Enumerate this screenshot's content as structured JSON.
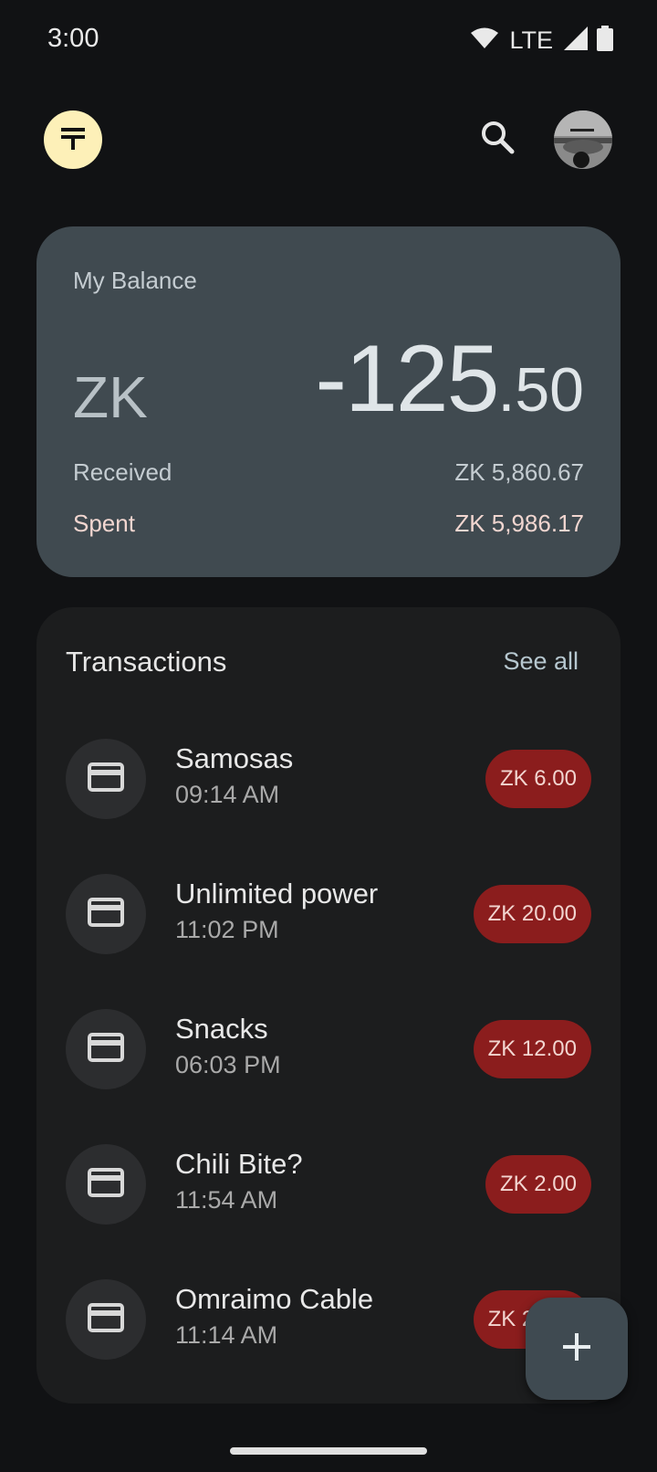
{
  "status_bar": {
    "time": "3:00",
    "network": "LTE",
    "icons": [
      "wifi-icon",
      "cell-signal-icon",
      "battery-icon"
    ]
  },
  "app_bar": {
    "logo_icon": "currency-logo-icon",
    "search_icon": "search-icon",
    "avatar": "profile-avatar"
  },
  "balance": {
    "label": "My Balance",
    "currency": "ZK",
    "amount_int": "-125",
    "amount_dec": ".50",
    "received_label": "Received",
    "received_value": "ZK 5,860.67",
    "spent_label": "Spent",
    "spent_value": "ZK 5,986.17"
  },
  "transactions": {
    "title": "Transactions",
    "see_all": "See all",
    "items": [
      {
        "name": "Samosas",
        "time": "09:14 AM",
        "amount": "ZK 6.00",
        "icon": "card-icon"
      },
      {
        "name": "Unlimited power",
        "time": "11:02 PM",
        "amount": "ZK 20.00",
        "icon": "card-icon"
      },
      {
        "name": "Snacks",
        "time": "06:03 PM",
        "amount": "ZK 12.00",
        "icon": "card-icon"
      },
      {
        "name": "Chili Bite?",
        "time": "11:54 AM",
        "amount": "ZK 2.00",
        "icon": "card-icon"
      },
      {
        "name": "Omraimo Cable",
        "time": "11:14 AM",
        "amount": "ZK 25.00",
        "icon": "card-icon"
      }
    ]
  },
  "fab": {
    "icon": "plus-icon"
  },
  "colors": {
    "background": "#111214",
    "balance_card": "#404a50",
    "tx_card": "#1c1d1e",
    "amount_chip": "#8b1d1d",
    "logo_bg": "#fdf0b8"
  }
}
